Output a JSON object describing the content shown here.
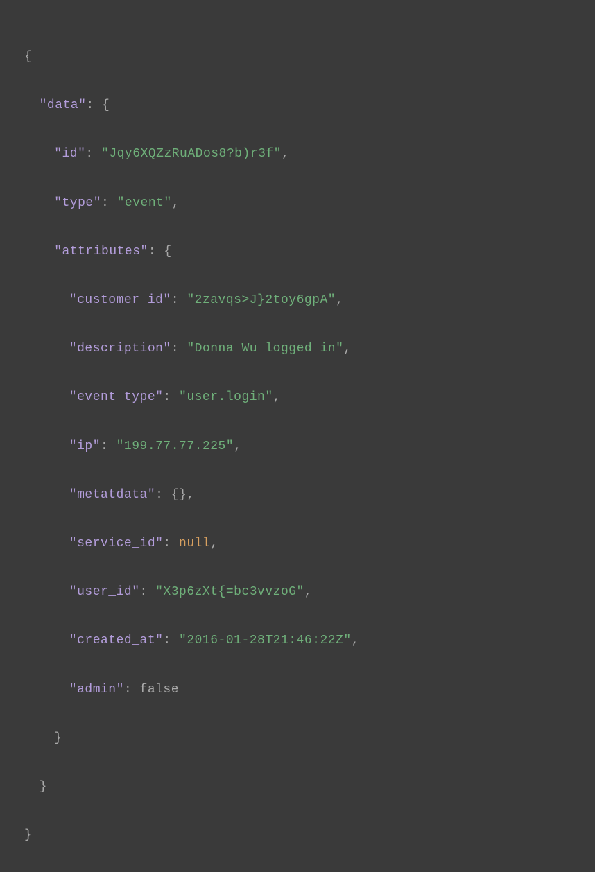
{
  "keys": {
    "data": "\"data\"",
    "id": "\"id\"",
    "type": "\"type\"",
    "attributes": "\"attributes\"",
    "customer_id": "\"customer_id\"",
    "description": "\"description\"",
    "event_type": "\"event_type\"",
    "ip": "\"ip\"",
    "metatdata": "\"metatdata\"",
    "service_id": "\"service_id\"",
    "user_id": "\"user_id\"",
    "created_at": "\"created_at\"",
    "admin": "\"admin\""
  },
  "values": {
    "id": "\"Jqy6XQZzRuADos8?b)r3f\"",
    "type": "\"event\"",
    "customer_id": "\"2zavqs>J}2toy6gpA\"",
    "description": "\"Donna Wu logged in\"",
    "event_type": "\"user.login\"",
    "ip": "\"199.77.77.225\"",
    "metatdata": "{}",
    "service_id": "null",
    "user_id": "\"X3p6zXt{=bc3vvzoG\"",
    "created_at": "\"2016-01-28T21:46:22Z\"",
    "admin": "false"
  },
  "punct": {
    "open_brace": "{",
    "close_brace": "}",
    "colon_open_brace": ": {",
    "colon_space": ": ",
    "comma": ","
  }
}
